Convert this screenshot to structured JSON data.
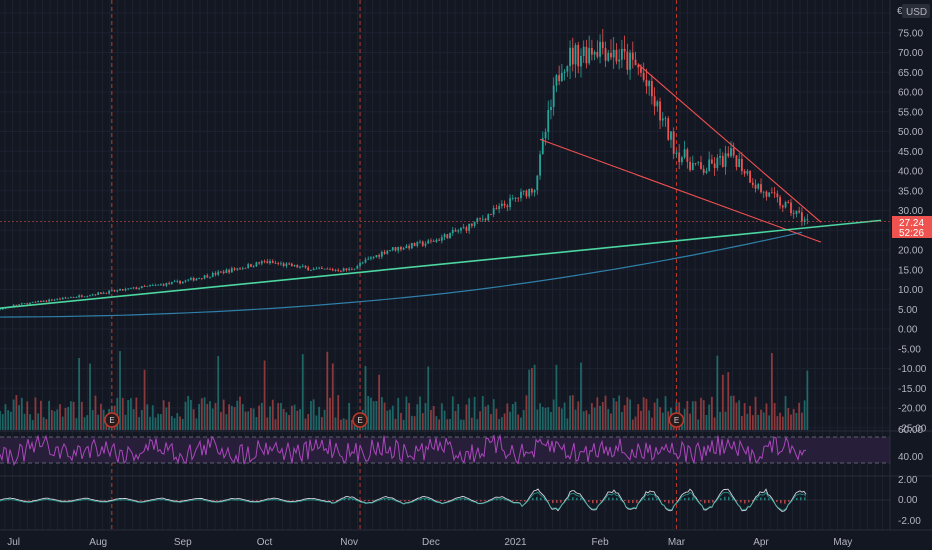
{
  "header": {
    "currency_label": "USD",
    "currency_symbol": "€"
  },
  "price_tag": {
    "price": "27.24",
    "countdown": "52:26"
  },
  "earnings_marker": "E",
  "colors": {
    "background": "#131722",
    "up_candle": "#26a69a",
    "down_candle": "#ef5350",
    "trendline_red": "#f05050",
    "trendline_green": "#4cd7a0",
    "ma_line": "#2f7fa8",
    "rsi_line": "#ab47bc",
    "rsi_band": "#2a1f3d",
    "price_tag_bg": "#ef5350",
    "macd_line": "#d1d4dc",
    "earnings_line": "#c0392b"
  },
  "chart_data": {
    "type": "candlestick",
    "x_tick_labels": [
      "Jul",
      "Aug",
      "Sep",
      "Oct",
      "Nov",
      "Dec",
      "2021",
      "Feb",
      "Mar",
      "Apr",
      "May"
    ],
    "price_axis": {
      "ticks": [
        "75.00",
        "70.00",
        "65.00",
        "60.00",
        "55.00",
        "50.00",
        "45.00",
        "40.00",
        "35.00",
        "30.00",
        "25.00",
        "20.00",
        "15.00",
        "10.00",
        "5.00",
        "0.00",
        "-5.00",
        "-10.00",
        "-15.00",
        "-20.00",
        "-25.00"
      ],
      "range": [
        -25,
        80
      ]
    },
    "rsi_axis": {
      "ticks": [
        "60.00",
        "40.00"
      ],
      "band": [
        30,
        70
      ]
    },
    "macd_axis": {
      "ticks": [
        "2.00",
        "0.00",
        "-2.00"
      ]
    },
    "price_keyframes": [
      [
        "2020-06-15",
        3
      ],
      [
        "2020-07-01",
        6
      ],
      [
        "2020-08-01",
        9
      ],
      [
        "2020-09-01",
        12
      ],
      [
        "2020-10-01",
        17
      ],
      [
        "2020-10-20",
        15
      ],
      [
        "2020-11-01",
        15
      ],
      [
        "2020-11-15",
        20
      ],
      [
        "2020-12-01",
        22
      ],
      [
        "2020-12-15",
        26
      ],
      [
        "2021-01-01",
        33
      ],
      [
        "2021-01-08",
        36
      ],
      [
        "2021-01-12",
        50
      ],
      [
        "2021-01-18",
        68
      ],
      [
        "2021-02-01",
        72
      ],
      [
        "2021-02-15",
        66
      ],
      [
        "2021-03-01",
        45
      ],
      [
        "2021-03-10",
        40
      ],
      [
        "2021-03-22",
        44
      ],
      [
        "2021-04-01",
        35
      ],
      [
        "2021-04-10",
        31
      ],
      [
        "2021-04-18",
        27.24
      ]
    ],
    "last_price": 27.24,
    "earnings_dates": [
      "2020-08-06",
      "2020-11-05",
      "2021-03-01"
    ],
    "annotations": [
      {
        "type": "trendline",
        "color": "red",
        "from": [
          "2021-02-15",
          67
        ],
        "to": [
          "2021-04-23",
          27
        ]
      },
      {
        "type": "trendline",
        "color": "red",
        "from": [
          "2021-01-10",
          48
        ],
        "to": [
          "2021-04-23",
          22
        ]
      },
      {
        "type": "trendline",
        "color": "green",
        "from": [
          "2020-06-15",
          4.5
        ],
        "to": [
          "2021-05-15",
          27.5
        ]
      },
      {
        "type": "moving_average",
        "color": "blue"
      }
    ]
  }
}
